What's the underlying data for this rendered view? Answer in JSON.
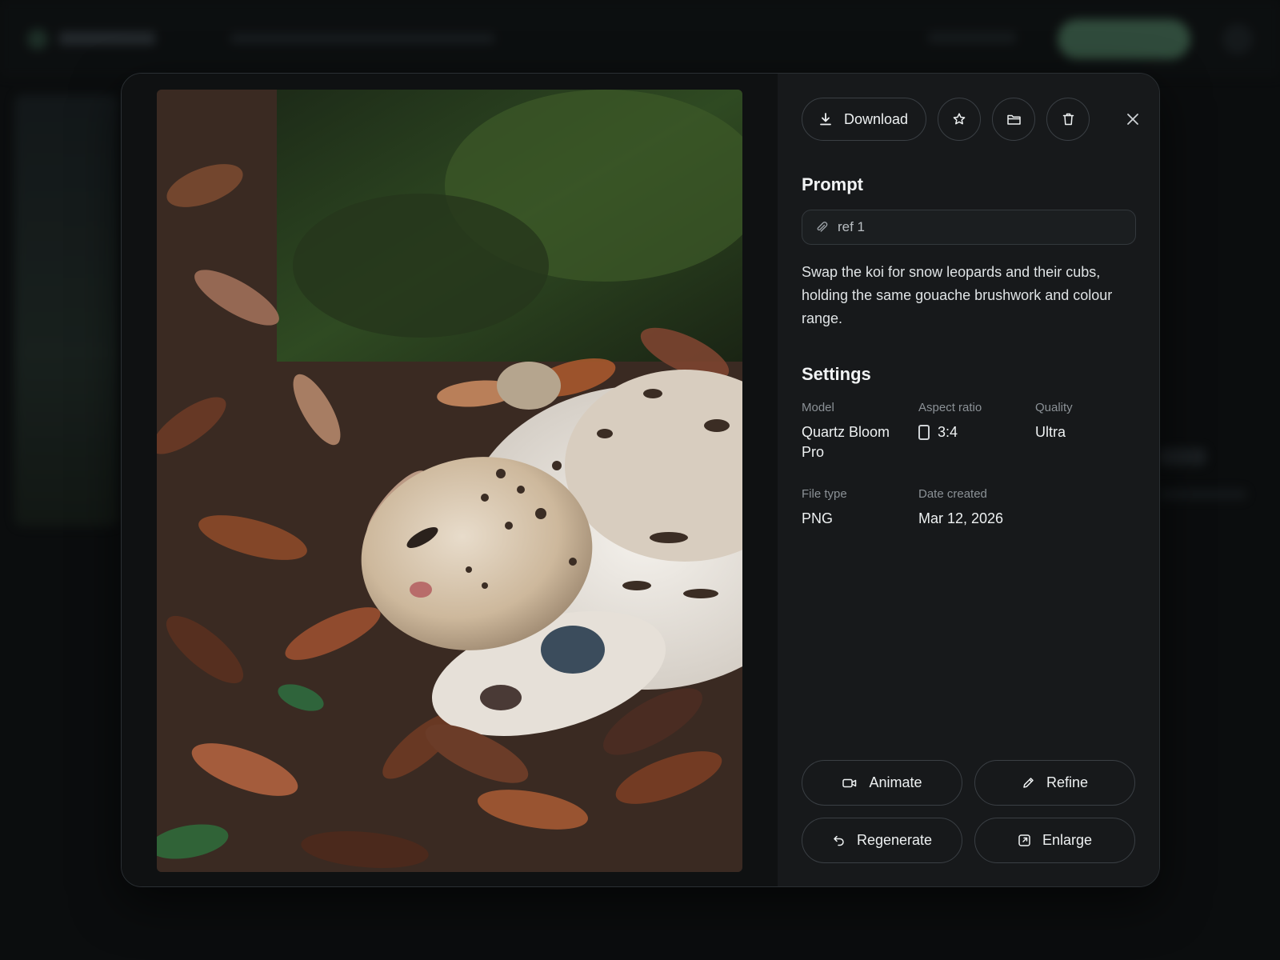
{
  "toolbar": {
    "download_label": "Download",
    "favorite_icon": "star-icon",
    "folder_icon": "folder-icon",
    "delete_icon": "trash-icon",
    "close_icon": "close-icon"
  },
  "prompt": {
    "heading": "Prompt",
    "reference": "ref 1",
    "text": "Swap the koi for snow leopards and their cubs, holding the same gouache brushwork and colour range."
  },
  "settings": {
    "heading": "Settings",
    "model_label": "Model",
    "model_value": "Quartz Bloom Pro",
    "aspect_label": "Aspect ratio",
    "aspect_value": "3:4",
    "quality_label": "Quality",
    "quality_value": "Ultra",
    "filetype_label": "File type",
    "filetype_value": "PNG",
    "date_label": "Date created",
    "date_value": "Mar 12, 2026"
  },
  "actions": {
    "animate": "Animate",
    "refine": "Refine",
    "regenerate": "Regenerate",
    "enlarge": "Enlarge"
  },
  "colors": {
    "accent": "#4f7f62",
    "panel": "#17191b",
    "border": "#3a3f44"
  }
}
